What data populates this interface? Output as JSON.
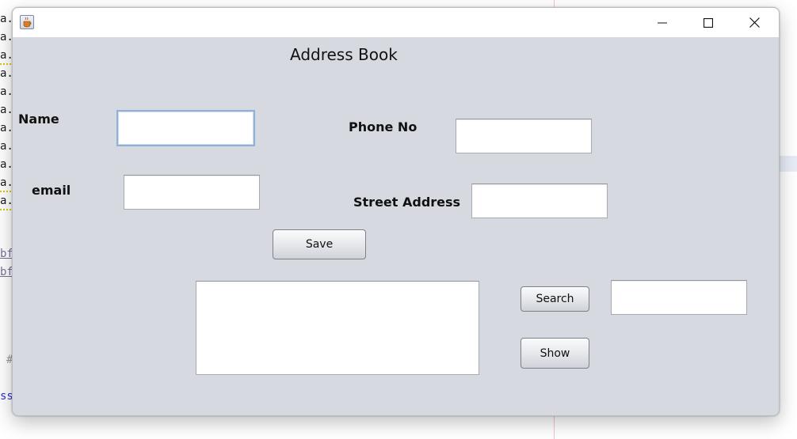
{
  "background_editor": {
    "code_fragments": [
      "a.",
      "a.",
      "a.",
      "a.",
      "a.",
      "a.",
      "a.",
      "a.",
      "a.",
      "a.",
      "a.",
      "bf",
      "bf",
      "#",
      "ss"
    ]
  },
  "window": {
    "app_icon": "java-coffee-cup-icon",
    "controls": {
      "minimize_icon": "minimize-icon",
      "maximize_icon": "maximize-icon",
      "close_icon": "close-icon"
    },
    "title_bar_color": "#ffffff",
    "content_color": "#d6d9e0"
  },
  "form": {
    "heading": "Address Book",
    "name_label": "Name",
    "name_value": "",
    "phone_label": "Phone No",
    "phone_value": "",
    "email_label": "email",
    "email_value": "",
    "street_label": "Street Address",
    "street_value": "",
    "save_label": "Save",
    "output_text": "",
    "search_label": "Search",
    "search_value": "",
    "show_label": "Show"
  }
}
